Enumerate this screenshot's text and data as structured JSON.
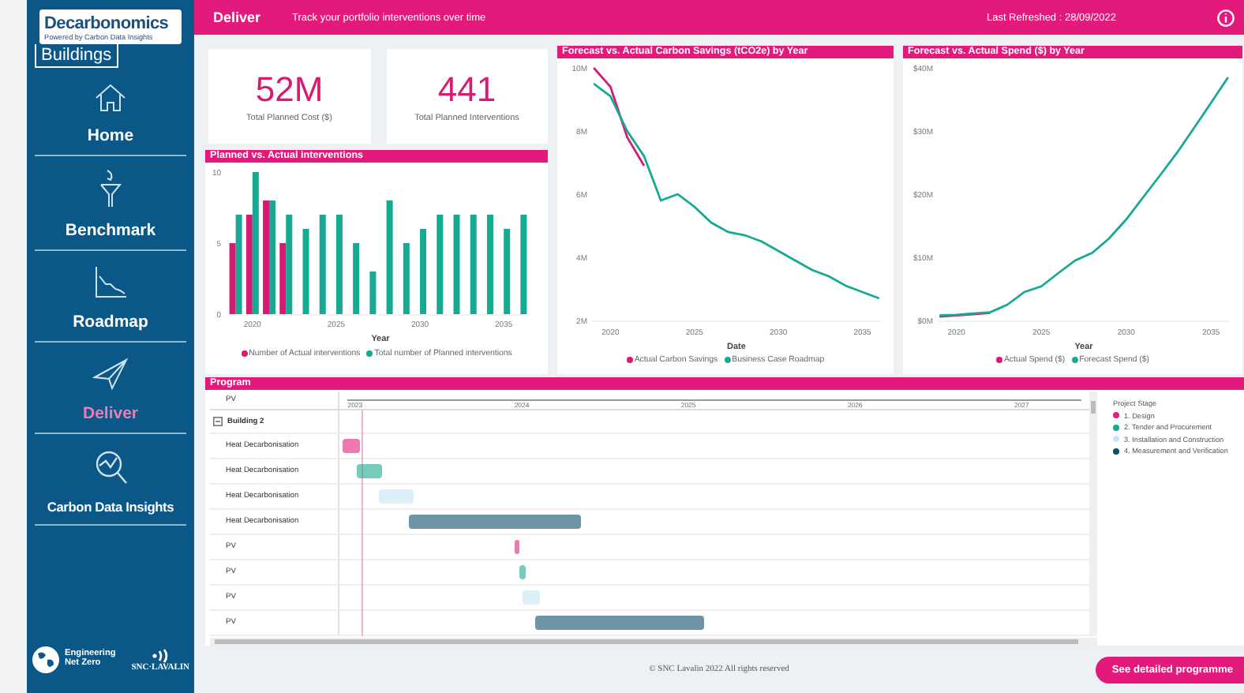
{
  "sidebar": {
    "brand": "Decarbonomics",
    "tagline": "Powered by Carbon Data Insights",
    "product": "Buildings",
    "items": [
      {
        "label": "Home",
        "selected": false
      },
      {
        "label": "Benchmark",
        "selected": false
      },
      {
        "label": "Roadmap",
        "selected": false
      },
      {
        "label": "Deliver",
        "selected": true
      },
      {
        "label": "Carbon Data Insights",
        "selected": false
      }
    ],
    "partner_logos": {
      "first": [
        "Engineering",
        "Net Zero"
      ],
      "second": "SNC·LAVALIN"
    }
  },
  "header": {
    "title": "Deliver",
    "subtitle": "Track your portfolio interventions over time",
    "refreshed": "Last Refreshed : 28/09/2022"
  },
  "kpis": [
    {
      "value": "52M",
      "label": "Total Planned Cost ($)"
    },
    {
      "value": "441",
      "label": "Total Planned Interventions"
    }
  ],
  "interventions_chart": {
    "chart_data": {
      "type": "bar",
      "title": "Planned vs. Actual interventions",
      "xlabel": "Year",
      "x": [
        2019,
        2020,
        2021,
        2022,
        2023,
        2024,
        2025,
        2026,
        2027,
        2028,
        2029,
        2030,
        2031,
        2032,
        2033,
        2034,
        2035,
        2036
      ],
      "xlim": [
        2018.5,
        2036.5
      ],
      "xticks": [
        2020,
        2025,
        2030,
        2035
      ],
      "ylim": [
        0,
        10
      ],
      "yticks": [
        0,
        5,
        10
      ],
      "series": [
        {
          "name": "Number of Actual interventions",
          "color": "#d81b72",
          "values": [
            5,
            7,
            8,
            5,
            null,
            null,
            null,
            null,
            null,
            null,
            null,
            null,
            null,
            null,
            null,
            null,
            null,
            null
          ]
        },
        {
          "name": "Total number of Planned interventions",
          "color": "#17a992",
          "values": [
            7,
            10,
            8,
            7,
            6,
            7,
            7,
            5,
            3,
            8,
            5,
            6,
            7,
            7,
            7,
            7,
            6,
            7
          ]
        }
      ]
    }
  },
  "carbon_chart": {
    "chart_data": {
      "type": "line",
      "title": "Forecast vs. Actual Carbon Savings (tCO2e) by Year",
      "xlabel": "Date",
      "x": [
        2019,
        2020,
        2021,
        2022,
        2023,
        2024,
        2025,
        2026,
        2027,
        2028,
        2029,
        2030,
        2031,
        2032,
        2033,
        2034,
        2035,
        2036
      ],
      "xlim": [
        2018.9,
        2036.1
      ],
      "ylim": [
        2,
        10
      ],
      "xticks": [
        2020,
        2025,
        2030,
        2035
      ],
      "yticks": [
        {
          "value": 2,
          "label": "2M"
        },
        {
          "value": 4,
          "label": "4M"
        },
        {
          "value": 6,
          "label": "6M"
        },
        {
          "value": 8,
          "label": "8M"
        },
        {
          "value": 10,
          "label": "10M"
        }
      ],
      "series": [
        {
          "name": "Actual Carbon Savings",
          "color": "#d81b72",
          "values": [
            10.0,
            9.4,
            7.8,
            6.9,
            null,
            null,
            null,
            null,
            null,
            null,
            null,
            null,
            null,
            null,
            null,
            null,
            null,
            null
          ]
        },
        {
          "name": "Business Case Roadmap",
          "color": "#17a992",
          "values": [
            9.5,
            9.1,
            8.0,
            7.2,
            5.8,
            6.0,
            5.6,
            5.1,
            4.8,
            4.7,
            4.5,
            4.2,
            3.9,
            3.6,
            3.4,
            3.1,
            2.9,
            2.7
          ]
        }
      ]
    }
  },
  "spend_chart": {
    "chart_data": {
      "type": "line",
      "title": "Forecast vs. Actual Spend ($) by Year",
      "xlabel": "Year",
      "x": [
        2019,
        2020,
        2021,
        2022,
        2023,
        2024,
        2025,
        2026,
        2027,
        2028,
        2029,
        2030,
        2031,
        2032,
        2033,
        2034,
        2035,
        2036
      ],
      "xlim": [
        2018.9,
        2036.1
      ],
      "ylim": [
        0,
        40
      ],
      "xticks": [
        2020,
        2025,
        2030,
        2035
      ],
      "yticks": [
        {
          "value": 0,
          "label": "$0M"
        },
        {
          "value": 10,
          "label": "$10M"
        },
        {
          "value": 20,
          "label": "$20M"
        },
        {
          "value": 30,
          "label": "$30M"
        },
        {
          "value": 40,
          "label": "$40M"
        }
      ],
      "series": [
        {
          "name": "Actual Spend ($)",
          "color": "#d81b72",
          "values": [
            0.6,
            0.8,
            1.0,
            1.2,
            null,
            null,
            null,
            null,
            null,
            null,
            null,
            null,
            null,
            null,
            null,
            null,
            null,
            null
          ]
        },
        {
          "name": "Forecast Spend ($)",
          "color": "#17a992",
          "values": [
            0.8,
            0.9,
            1.1,
            1.3,
            2.5,
            4.5,
            5.4,
            7.5,
            9.5,
            10.7,
            13,
            16,
            19.5,
            23,
            26.6,
            30.5,
            34.5,
            38.5
          ]
        }
      ]
    }
  },
  "program": {
    "title": "Program",
    "column_header": "PV",
    "axis_labels": [
      "2023",
      "2024",
      "2025",
      "2026",
      "2027"
    ],
    "group": {
      "label": "Building 2",
      "expanded": true
    },
    "rows": [
      {
        "label": "Heat Decarbonisation",
        "kind": "design"
      },
      {
        "label": "Heat Decarbonisation",
        "kind": "tender"
      },
      {
        "label": "Heat Decarbonisation",
        "kind": "installation"
      },
      {
        "label": "Heat Decarbonisation",
        "kind": "measurement"
      },
      {
        "label": "PV",
        "kind": "design"
      },
      {
        "label": "PV",
        "kind": "tender"
      },
      {
        "label": "PV",
        "kind": "installation"
      },
      {
        "label": "PV",
        "kind": "measurement"
      }
    ],
    "legend": {
      "title": "Project Stage",
      "items": [
        {
          "label": "1. Design",
          "color": "#e0207a"
        },
        {
          "label": "2. Tender and Procurement",
          "color": "#1aa88e"
        },
        {
          "label": "3. Installation and Construction",
          "color": "#c6e6f7"
        },
        {
          "label": "4. Measurement and Verification",
          "color": "#0d4f6b"
        }
      ]
    }
  },
  "footer": {
    "copyright": "© SNC Lavalin 2022 All rights reserved",
    "button": "See detailed programme"
  }
}
